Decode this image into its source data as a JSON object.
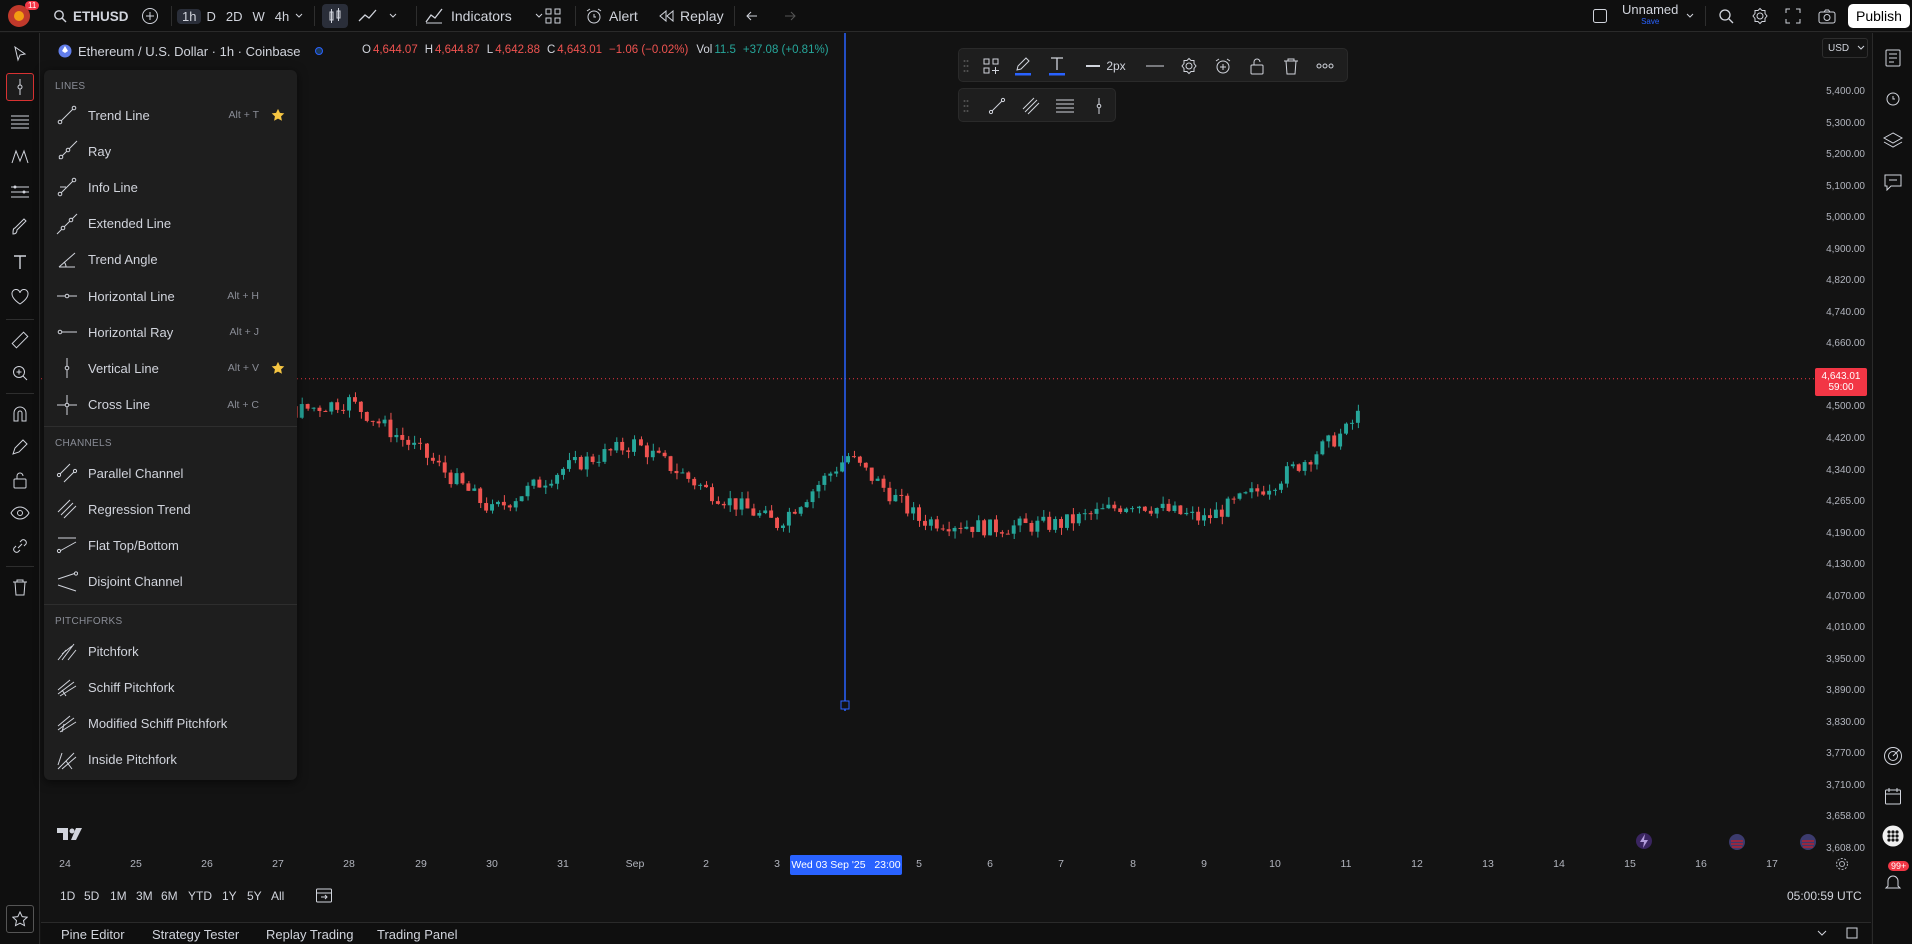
{
  "topbar": {
    "notif_count": "11",
    "symbol": "ETHUSD",
    "intervals": [
      "1h",
      "D",
      "2D",
      "W",
      "4h"
    ],
    "active_interval": "1h",
    "indicators_label": "Indicators",
    "alert_label": "Alert",
    "replay_label": "Replay",
    "layout_name": "Unnamed",
    "layout_sub": "Save",
    "publish_label": "Publish"
  },
  "legend": {
    "title": "Ethereum / U.S. Dollar · 1h · Coinbase",
    "o_label": "O",
    "o": "4,644.07",
    "h_label": "H",
    "h": "4,644.87",
    "l_label": "L",
    "l": "4,642.88",
    "c_label": "C",
    "c": "4,643.01",
    "change": "−1.06 (−0.02%)",
    "vol_label": "Vol",
    "vol": "11.5",
    "vol_change": "+37.08 (+0.81%)"
  },
  "drawing_menu": {
    "lines_header": "LINES",
    "lines": [
      {
        "label": "Trend Line",
        "shortcut": "Alt + T",
        "starred": true,
        "icon": "trend-line-icon"
      },
      {
        "label": "Ray",
        "shortcut": "",
        "starred": false,
        "icon": "ray-icon"
      },
      {
        "label": "Info Line",
        "shortcut": "",
        "starred": false,
        "icon": "info-line-icon"
      },
      {
        "label": "Extended Line",
        "shortcut": "",
        "starred": false,
        "icon": "extended-line-icon"
      },
      {
        "label": "Trend Angle",
        "shortcut": "",
        "starred": false,
        "icon": "trend-angle-icon"
      },
      {
        "label": "Horizontal Line",
        "shortcut": "Alt + H",
        "starred": false,
        "icon": "horizontal-line-icon"
      },
      {
        "label": "Horizontal Ray",
        "shortcut": "Alt + J",
        "starred": false,
        "icon": "horizontal-ray-icon"
      },
      {
        "label": "Vertical Line",
        "shortcut": "Alt + V",
        "starred": true,
        "icon": "vertical-line-icon"
      },
      {
        "label": "Cross Line",
        "shortcut": "Alt + C",
        "starred": false,
        "icon": "cross-line-icon"
      }
    ],
    "channels_header": "CHANNELS",
    "channels": [
      {
        "label": "Parallel Channel",
        "icon": "parallel-channel-icon"
      },
      {
        "label": "Regression Trend",
        "icon": "regression-trend-icon"
      },
      {
        "label": "Flat Top/Bottom",
        "icon": "flat-top-bottom-icon"
      },
      {
        "label": "Disjoint Channel",
        "icon": "disjoint-channel-icon"
      }
    ],
    "pitchforks_header": "PITCHFORKS",
    "pitchforks": [
      {
        "label": "Pitchfork",
        "icon": "pitchfork-icon"
      },
      {
        "label": "Schiff Pitchfork",
        "icon": "schiff-pitchfork-icon"
      },
      {
        "label": "Modified Schiff Pitchfork",
        "icon": "modified-schiff-pitchfork-icon"
      },
      {
        "label": "Inside Pitchfork",
        "icon": "inside-pitchfork-icon"
      }
    ]
  },
  "float_toolbar": {
    "width_label": "2px"
  },
  "yaxis": {
    "currency": "USD",
    "ticks": [
      "5,400.00",
      "5,300.00",
      "5,200.00",
      "5,100.00",
      "5,000.00",
      "4,900.00",
      "4,820.00",
      "4,740.00",
      "4,660.00",
      "4,580.00",
      "4,500.00",
      "4,420.00",
      "4,340.00",
      "4,265.00",
      "4,190.00",
      "4,130.00",
      "4,070.00",
      "4,010.00",
      "3,950.00",
      "3,890.00",
      "3,830.00",
      "3,770.00",
      "3,710.00",
      "3,658.00",
      "3,608.00"
    ],
    "price_tag": "4,643.01",
    "countdown": "59:00"
  },
  "xaxis": {
    "ticks": [
      "24",
      "25",
      "26",
      "27",
      "28",
      "29",
      "30",
      "31",
      "Sep",
      "2",
      "3",
      "5",
      "6",
      "7",
      "8",
      "9",
      "10",
      "11",
      "12",
      "13",
      "14",
      "15",
      "16",
      "17"
    ],
    "crosshair_label": "Wed 03 Sep '25   23:00"
  },
  "rangebar": {
    "ranges": [
      "1D",
      "5D",
      "1M",
      "3M",
      "6M",
      "YTD",
      "1Y",
      "5Y",
      "All"
    ],
    "clock": "05:00:59 UTC"
  },
  "bottom_tabs": [
    "Pine Editor",
    "Strategy Tester",
    "Replay Trading",
    "Trading Panel"
  ],
  "right_badge": "99+",
  "colors": {
    "up": "#26a69a",
    "down": "#ef5350",
    "crosshair": "#2962ff",
    "accent": "#2962ff"
  },
  "chart_data": {
    "type": "candlestick",
    "symbol": "ETHUSD",
    "interval": "1h",
    "x": [
      "24",
      "25",
      "26",
      "27",
      "28",
      "29",
      "30",
      "31",
      "Sep",
      "2",
      "3",
      "5",
      "6",
      "7",
      "8",
      "9",
      "10",
      "11",
      "12",
      "13",
      "14",
      "15"
    ],
    "close_approx": [
      4400,
      4500,
      4460,
      4560,
      4590,
      4470,
      4330,
      4430,
      4490,
      4380,
      4300,
      4460,
      4310,
      4290,
      4300,
      4350,
      4310,
      4400,
      4520,
      4740,
      4690,
      4643
    ],
    "last_price": 4643.01,
    "ylim": [
      3608,
      5400
    ]
  }
}
